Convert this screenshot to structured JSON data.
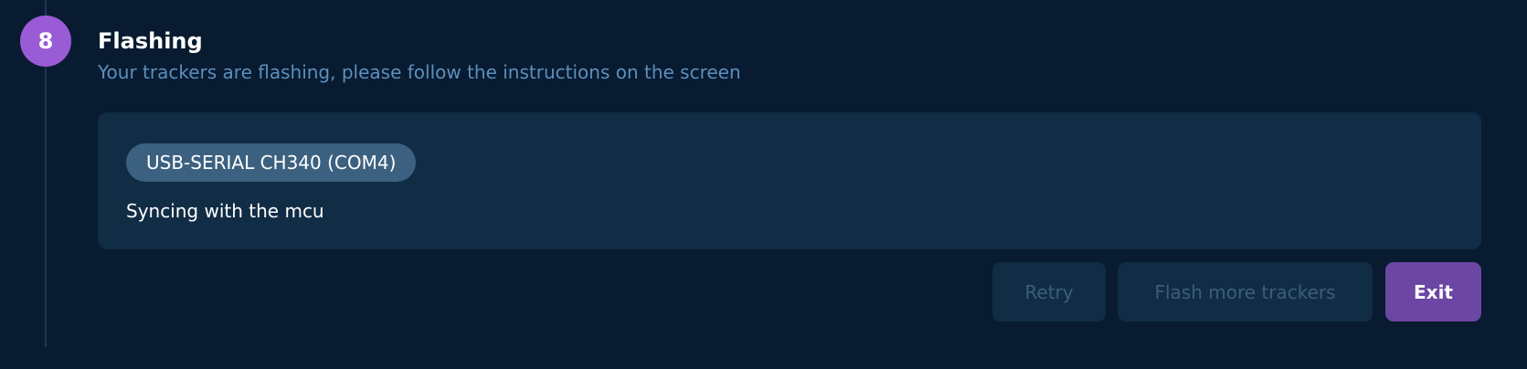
{
  "step": {
    "number": "8",
    "title": "Flashing",
    "subtitle": "Your trackers are flashing, please follow the instructions on the screen"
  },
  "device": {
    "name": "USB-SERIAL CH340 (COM4)",
    "status": "Syncing with the mcu"
  },
  "actions": {
    "retry_label": "Retry",
    "flash_more_label": "Flash more trackers",
    "exit_label": "Exit"
  },
  "colors": {
    "background": "#081b30",
    "panel": "#112c45",
    "step_accent": "#9a5bd6",
    "exit_button": "#6b46a3",
    "subtitle": "#5c8fbd",
    "pill": "#3c6180"
  }
}
